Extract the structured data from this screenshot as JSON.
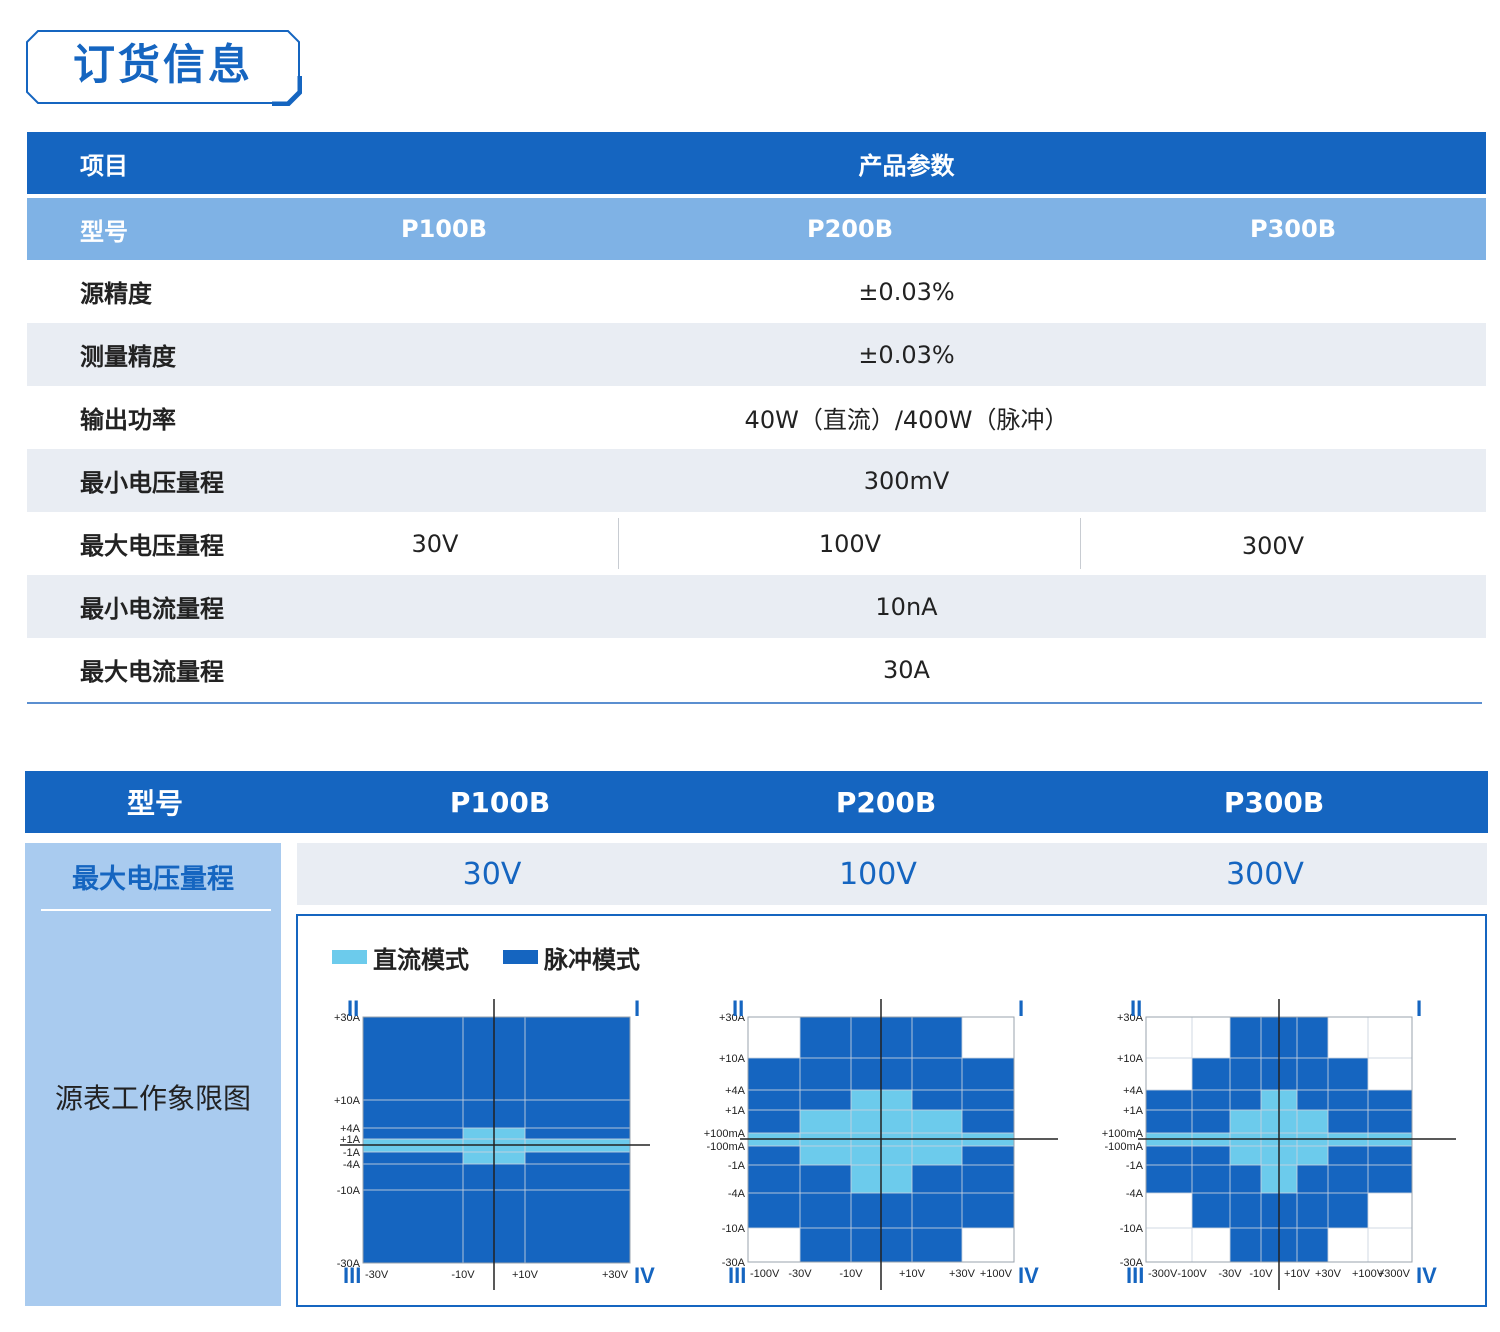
{
  "title": "订货信息",
  "spec_table": {
    "header": {
      "item": "项目",
      "params": "产品参数"
    },
    "model_row": {
      "label": "型号",
      "models": [
        "P100B",
        "P200B",
        "P300B"
      ]
    },
    "rows": [
      {
        "label": "源精度",
        "value": "±0.03%"
      },
      {
        "label": "测量精度",
        "value": "±0.03%"
      },
      {
        "label": "输出功率",
        "value": "40W（直流）/400W（脉冲）"
      },
      {
        "label": "最小电压量程",
        "value": "300mV"
      },
      {
        "label": "最大电压量程",
        "values": [
          "30V",
          "100V",
          "300V"
        ]
      },
      {
        "label": "最小电流量程",
        "value": "10nA"
      },
      {
        "label": "最大电流量程",
        "value": "30A"
      }
    ]
  },
  "quadrant_table": {
    "header": {
      "label": "型号",
      "models": [
        "P100B",
        "P200B",
        "P300B"
      ]
    },
    "voltage_row": {
      "label": "最大电压量程",
      "values": [
        "30V",
        "100V",
        "300V"
      ]
    },
    "diagram_label": "源表工作象限图",
    "legend": [
      {
        "label": "直流模式",
        "color": "#6ccbec"
      },
      {
        "label": "脉冲模式",
        "color": "#1565c0"
      }
    ],
    "quadrant_labels": [
      "II",
      "I",
      "III",
      "IV"
    ]
  },
  "chart_data": [
    {
      "type": "heatmap",
      "title": "P100B",
      "x_ticks": [
        "-30V",
        "-10V",
        "+10V",
        "+30V"
      ],
      "y_ticks": [
        "+30A",
        "+10A",
        "+4A",
        "+1A",
        "-1A",
        "-4A",
        "-10A",
        "-30A"
      ],
      "dc_region": [
        {
          "v": [
            -30,
            30
          ],
          "i": [
            -1,
            1
          ]
        },
        {
          "v": [
            -10,
            10
          ],
          "i": [
            -4,
            4
          ]
        }
      ],
      "pulse_region": [
        {
          "v": [
            -30,
            30
          ],
          "i": [
            -30,
            30
          ]
        }
      ]
    },
    {
      "type": "heatmap",
      "title": "P200B",
      "x_ticks": [
        "-100V",
        "-30V",
        "-10V",
        "+10V",
        "+30V",
        "+100V"
      ],
      "y_ticks": [
        "+30A",
        "+10A",
        "+4A",
        "+1A",
        "+100mA",
        "-100mA",
        "-1A",
        "-4A",
        "-10A",
        "-30A"
      ],
      "dc_region": [
        {
          "v": [
            -100,
            100
          ],
          "i": [
            -0.1,
            0.1
          ]
        },
        {
          "v": [
            -30,
            30
          ],
          "i": [
            -1,
            1
          ]
        },
        {
          "v": [
            -10,
            10
          ],
          "i": [
            -4,
            4
          ]
        }
      ],
      "pulse_region": [
        {
          "v": [
            -100,
            100
          ],
          "i": [
            -10,
            10
          ]
        },
        {
          "v": [
            -30,
            30
          ],
          "i": [
            -30,
            30
          ]
        }
      ]
    },
    {
      "type": "heatmap",
      "title": "P300B",
      "x_ticks": [
        "-300V",
        "-100V",
        "-30V",
        "-10V",
        "+10V",
        "+30V",
        "+100V",
        "+300V"
      ],
      "y_ticks": [
        "+30A",
        "+10A",
        "+4A",
        "+1A",
        "+100mA",
        "-100mA",
        "-1A",
        "-4A",
        "-10A",
        "-30A"
      ],
      "dc_region": [
        {
          "v": [
            -300,
            300
          ],
          "i": [
            -0.1,
            0.1
          ]
        },
        {
          "v": [
            -30,
            30
          ],
          "i": [
            -1,
            1
          ]
        },
        {
          "v": [
            -10,
            10
          ],
          "i": [
            -4,
            4
          ]
        }
      ],
      "pulse_region": [
        {
          "v": [
            -300,
            300
          ],
          "i": [
            -4,
            4
          ]
        },
        {
          "v": [
            -100,
            100
          ],
          "i": [
            -10,
            10
          ]
        },
        {
          "v": [
            -30,
            30
          ],
          "i": [
            -30,
            30
          ]
        }
      ]
    }
  ]
}
